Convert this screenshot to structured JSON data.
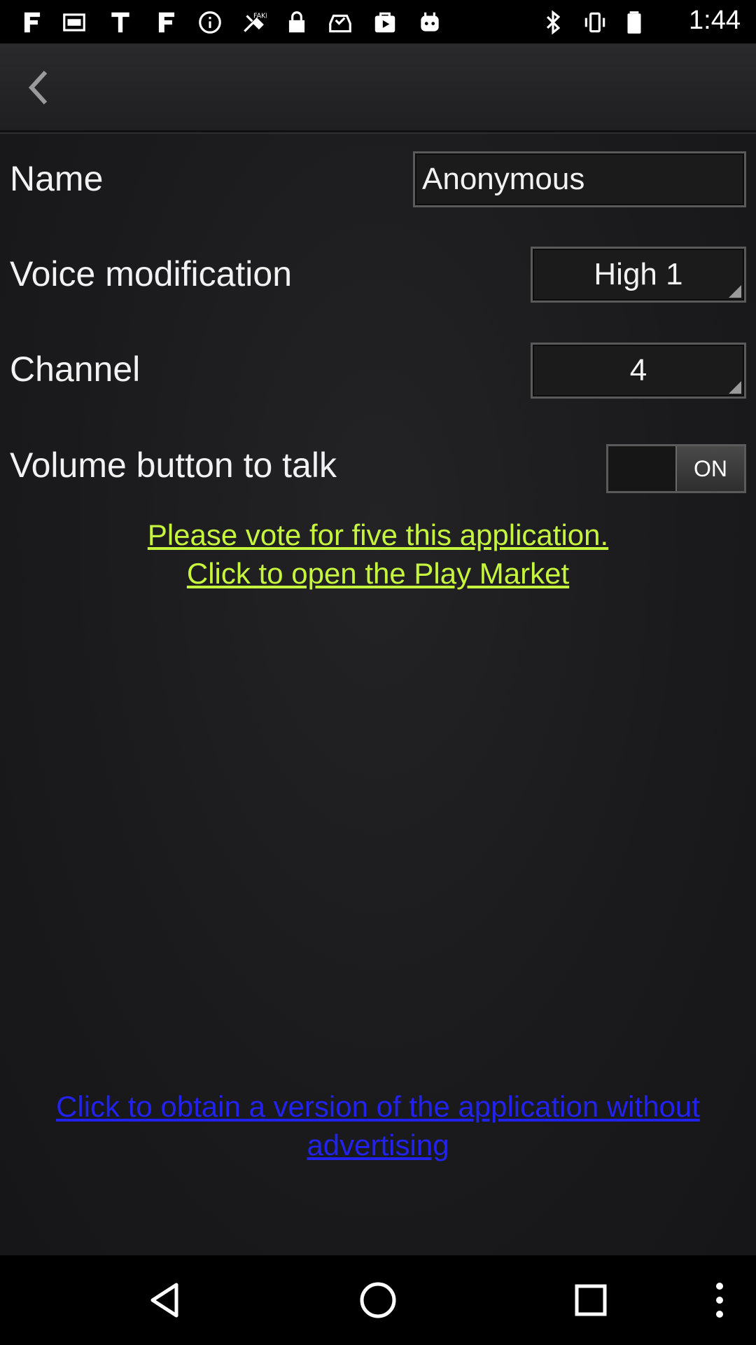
{
  "status_bar": {
    "time": "1:44",
    "left_icons": [
      "app-icon",
      "notification-icon",
      "text-icon",
      "app-icon",
      "info-icon",
      "fake-gps-icon",
      "lock-icon",
      "inbox-check-icon",
      "play-store-icon",
      "robot-icon"
    ],
    "right_icons": [
      "bluetooth-icon",
      "vibrate-icon",
      "battery-icon"
    ]
  },
  "action_bar": {
    "back_icon": "chevron-left-icon"
  },
  "settings": {
    "name": {
      "label": "Name",
      "value": "Anonymous"
    },
    "voice": {
      "label": "Voice modification",
      "value": "High 1"
    },
    "channel": {
      "label": "Channel",
      "value": "4"
    },
    "volume": {
      "label": "Volume button to talk",
      "toggle_state": "ON"
    }
  },
  "links": {
    "vote_line1": "Please vote for five this application.",
    "vote_line2": "Click to open the Play Market",
    "noads_line1": "Click to obtain a version of the application without",
    "noads_line2": "advertising"
  },
  "colors": {
    "vote_link": "#c6f53e",
    "noads_link": "#2222ee",
    "background": "#1b1b1d"
  },
  "nav_bar": {
    "icons": [
      "back-triangle-icon",
      "home-circle-icon",
      "recents-square-icon",
      "overflow-menu-icon"
    ]
  }
}
